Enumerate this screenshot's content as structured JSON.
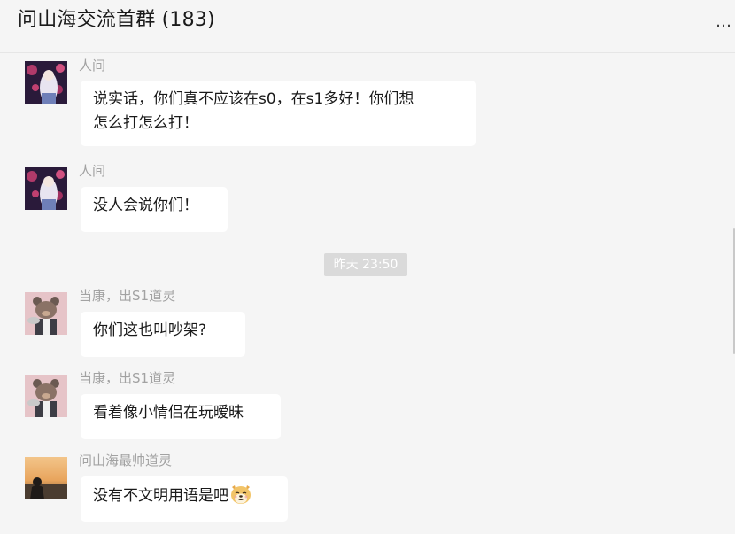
{
  "chat": {
    "title": "问山海交流首群 (183)",
    "more_label": "…"
  },
  "messages": [
    {
      "sender": "人间",
      "avatar": "avatar-anime-icon",
      "lines": [
        "说实话，你们真不应该在s0，在s1多好！你们想",
        "怎么打怎么打！"
      ]
    },
    {
      "sender": "人间",
      "avatar": "avatar-anime-icon",
      "lines": [
        "没人会说你们！"
      ]
    },
    {
      "sender": "当康，出S1道灵",
      "avatar": "avatar-bear-icon",
      "lines": [
        "你们这也叫吵架?"
      ]
    },
    {
      "sender": "当康，出S1道灵",
      "avatar": "avatar-bear-icon",
      "lines": [
        "看着像小情侣在玩暧昧"
      ]
    },
    {
      "sender": "问山海最帅道灵",
      "avatar": "avatar-sunset-icon",
      "lines": [
        "没有不文明用语是吧"
      ],
      "emoji": "doge-emoji-icon"
    }
  ],
  "time_separator": "昨天 23:50",
  "colors": {
    "background": "#f5f5f5",
    "bubble": "#ffffff",
    "sender_text": "#a2a2a2",
    "time_badge": "#dadada"
  }
}
